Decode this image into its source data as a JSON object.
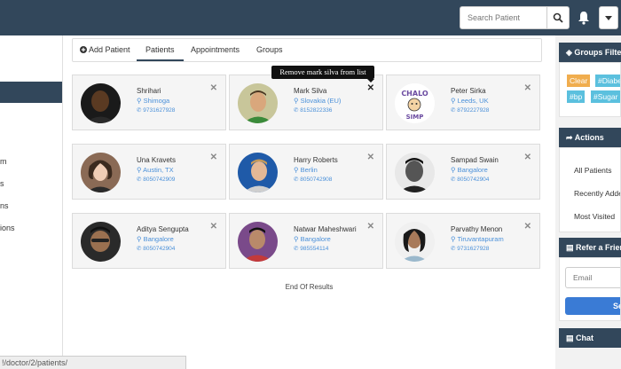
{
  "search": {
    "placeholder": "Search Patient"
  },
  "left_nav": {
    "items": [
      "m",
      "s",
      "ns",
      "ions"
    ]
  },
  "tabs": {
    "add_patient": "Add Patient",
    "patients": "Patients",
    "appointments": "Appointments",
    "groups": "Groups"
  },
  "tooltip": "Remove mark silva from list",
  "patients": [
    {
      "name": "Shrihari",
      "location": "Shimoga",
      "phone": "9731627928"
    },
    {
      "name": "Mark Silva",
      "location": "Slovakia (EU)",
      "phone": "8152822336"
    },
    {
      "name": "Peter Sirka",
      "location": "Leeds, UK",
      "phone": "8792227928"
    },
    {
      "name": "Una Kravets",
      "location": "Austin, TX",
      "phone": "8050742909"
    },
    {
      "name": "Harry Roberts",
      "location": "Berlin",
      "phone": "8050742908"
    },
    {
      "name": "Sampad Swain",
      "location": "Bangalore",
      "phone": "8050742904"
    },
    {
      "name": "Aditya Sengupta",
      "location": "Bangalore",
      "phone": "8050742904"
    },
    {
      "name": "Natwar Maheshwari",
      "location": "Bangalore",
      "phone": "985554114"
    },
    {
      "name": "Parvathy Menon",
      "location": "Tiruvantapuram",
      "phone": "9731627928"
    }
  ],
  "avatar_art": {
    "lettering": "CHALO SIMP"
  },
  "end_text": "End Of Results",
  "status_url": "!/doctor/2/patients/",
  "right": {
    "groups_title": "Groups Filter",
    "tags": [
      "Clear",
      "#Diabetes",
      "#bp",
      "#Sugar"
    ],
    "actions_title": "Actions",
    "actions": [
      "All Patients",
      "Recently Added",
      "Most Visited"
    ],
    "refer_title": "Refer a Friend",
    "email_placeholder": "Email",
    "send_label": "Send",
    "chat_title": "Chat"
  },
  "colors": {
    "navbar": "#32475b",
    "link": "#4a90d9",
    "tag": "#5bc0de",
    "tag_clear": "#f0ad4e",
    "send": "#3a7bd5"
  }
}
